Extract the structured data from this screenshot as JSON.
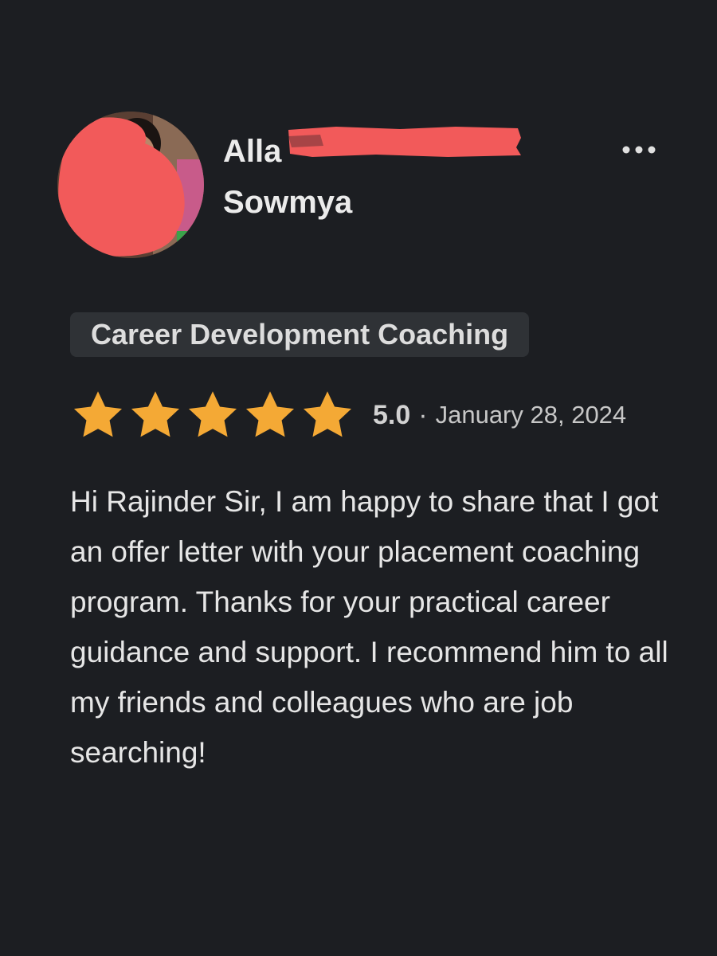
{
  "reviewer": {
    "name": "Alla",
    "last_name": "Sowmya",
    "avatar_icon": "user-photo-redacted"
  },
  "menu": {
    "icon": "more-horizontal-icon",
    "glyph": "•••"
  },
  "service_tag": "Career Development Coaching",
  "rating": {
    "stars": 5,
    "value": "5.0",
    "separator": "·",
    "date": "January 28, 2024",
    "star_color": "#f4a935"
  },
  "review_text": "Hi Rajinder Sir, I am happy to share that I got an offer letter with your placement coaching program. Thanks for your practical career guidance and support. I recommend him to all my friends and colleagues who are job searching!",
  "colors": {
    "background": "#1c1e22",
    "badge_background": "#2f3236",
    "redaction": "#f25a5a"
  }
}
